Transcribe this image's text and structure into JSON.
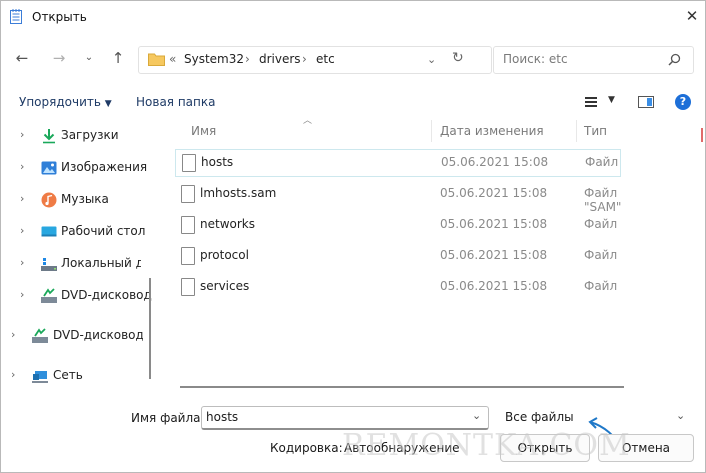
{
  "window": {
    "title": "Открыть"
  },
  "address": {
    "prefix": "«",
    "segments": [
      "System32",
      "drivers",
      "etc"
    ],
    "separator": "›"
  },
  "search": {
    "placeholder": "Поиск: etc"
  },
  "toolbar": {
    "organize": "Упорядочить",
    "new_folder": "Новая папка",
    "help": "?"
  },
  "sidebar": {
    "items": [
      {
        "label": "Загрузки",
        "icon": "download-icon"
      },
      {
        "label": "Изображения",
        "icon": "pictures-icon"
      },
      {
        "label": "Музыка",
        "icon": "music-icon"
      },
      {
        "label": "Рабочий стол",
        "icon": "desktop-icon"
      },
      {
        "label": "Локальный ди",
        "icon": "local-disk-icon"
      },
      {
        "label": "DVD-дисковод",
        "icon": "dvd-drive-icon"
      },
      {
        "label": "DVD-дисковод (I",
        "icon": "dvd-drive-icon"
      },
      {
        "label": "Сеть",
        "icon": "network-icon"
      }
    ]
  },
  "columns": {
    "name": "Имя",
    "date": "Дата изменения",
    "type": "Тип"
  },
  "files": [
    {
      "name": "hosts",
      "date": "05.06.2021 15:08",
      "type": "Файл"
    },
    {
      "name": "lmhosts.sam",
      "date": "05.06.2021 15:08",
      "type": "Файл \"SAM\""
    },
    {
      "name": "networks",
      "date": "05.06.2021 15:08",
      "type": "Файл"
    },
    {
      "name": "protocol",
      "date": "05.06.2021 15:08",
      "type": "Файл"
    },
    {
      "name": "services",
      "date": "05.06.2021 15:08",
      "type": "Файл"
    }
  ],
  "footer": {
    "filename_label": "Имя файла:",
    "filename_value": "hosts",
    "filter_value": "Все файлы",
    "encoding_label": "Кодировка:",
    "encoding_value": "Автообнаружение",
    "open_label": "Открыть",
    "cancel_label": "Отмена"
  },
  "watermark": "REMONTKA.COM",
  "colors": {
    "accent": "#1d6fd8",
    "selection_border": "#cde8ee",
    "arrow": "#1f78c8"
  }
}
